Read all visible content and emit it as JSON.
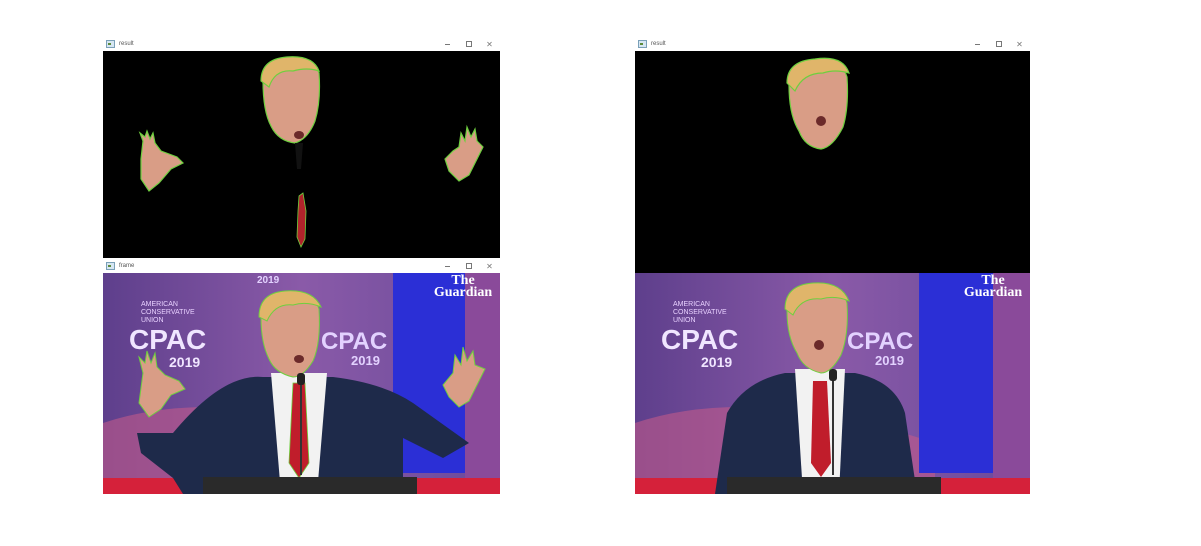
{
  "windows": {
    "left_result": {
      "title": "result"
    },
    "left_frame": {
      "title": "frame"
    },
    "right_result": {
      "title": "result"
    }
  },
  "controls": {
    "minimize": "–",
    "maximize": "□",
    "close": "✕"
  },
  "video": {
    "logo_line1": "The",
    "logo_line2": "Guardian",
    "banner_line1": "AMERICAN",
    "banner_line2": "CONSERVATIVE",
    "banner_line3": "UNION",
    "banner_big": "CPAC",
    "banner_year": "2019",
    "top_year": "2019"
  },
  "colors": {
    "mask_background": "#000000",
    "contour": "#6fcf3f",
    "skin": "#d99d86",
    "hair": "#e0b56a",
    "suit": "#1e2a4a",
    "tie": "#c01d2b",
    "stage_blue": "#2b2fd6",
    "stage_purple": "#6a4a9a"
  }
}
